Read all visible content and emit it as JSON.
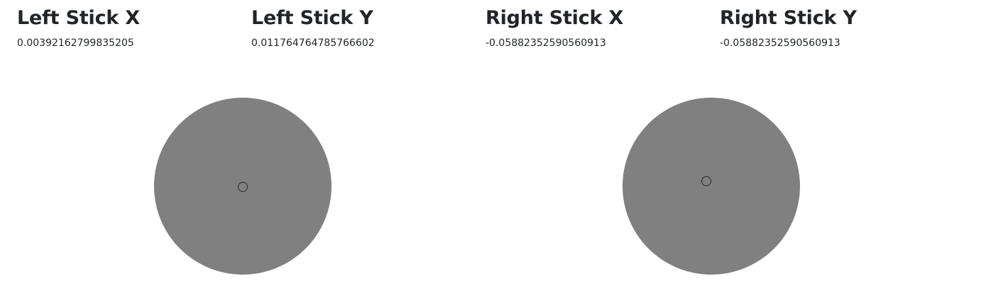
{
  "axes": {
    "left_x": {
      "label": "Left Stick X",
      "value": "0.00392162799835205"
    },
    "left_y": {
      "label": "Left Stick Y",
      "value": "0.011764764785766602"
    },
    "right_x": {
      "label": "Right Stick X",
      "value": "-0.05882352590560913"
    },
    "right_y": {
      "label": "Right Stick Y",
      "value": "-0.05882352590560913"
    }
  },
  "colors": {
    "stick_base": "#808080",
    "stick_indicator": "#2a2a2a",
    "text": "#212529"
  },
  "icons": {
    "left_indicator": "circle-outline-icon",
    "right_indicator": "circle-outline-icon"
  }
}
